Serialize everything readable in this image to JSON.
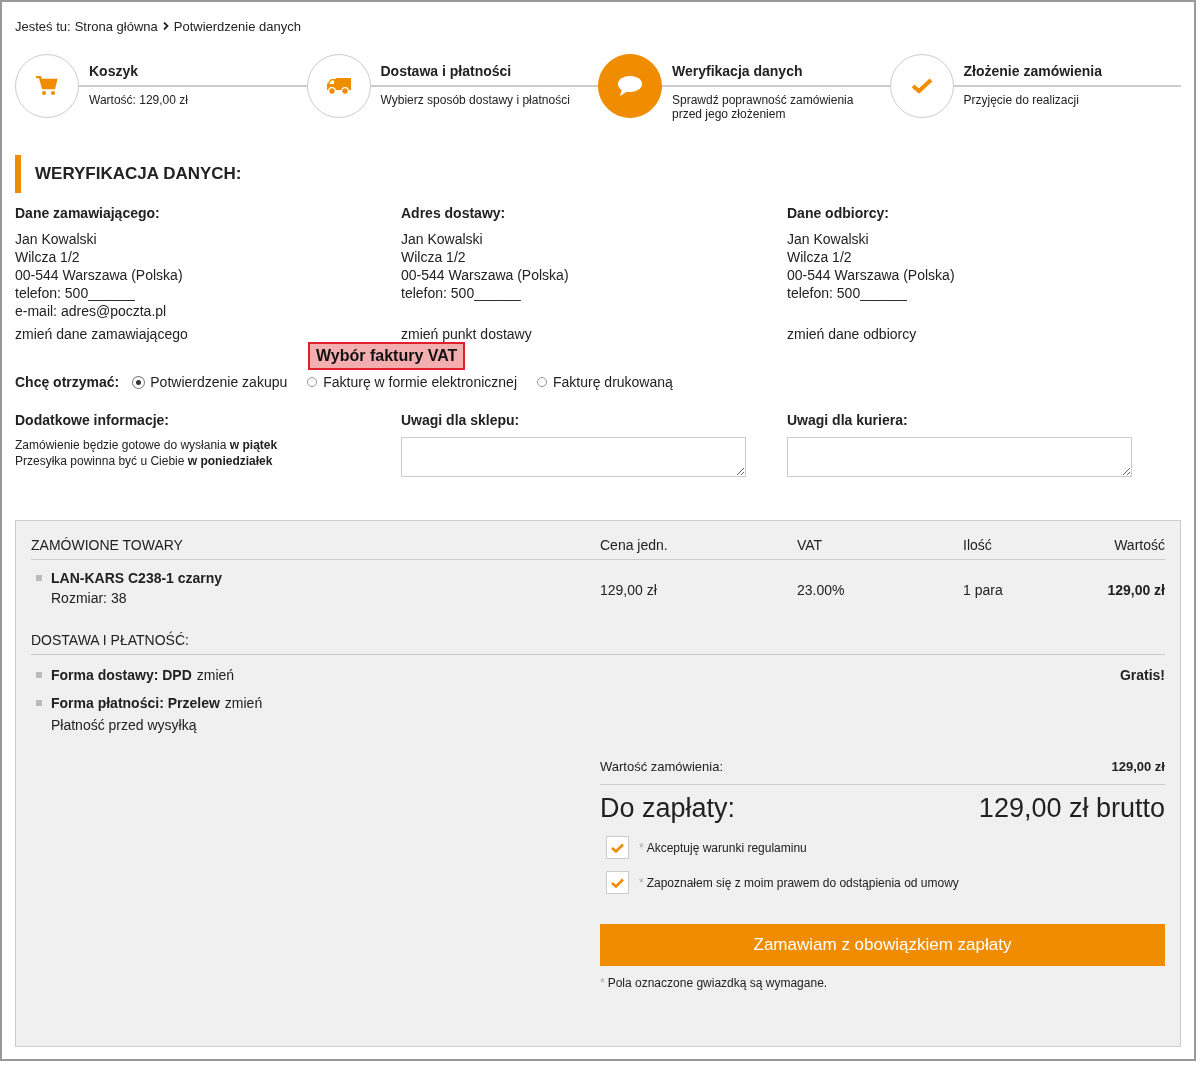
{
  "breadcrumb": {
    "label": "Jesteś tu:",
    "items": [
      "Strona główna",
      "Potwierdzenie danych"
    ]
  },
  "steps": [
    {
      "title": "Koszyk",
      "subtitle": "Wartość: 129,00 zł",
      "kind": "cart",
      "selected": false
    },
    {
      "title": "Dostawa i płatności",
      "subtitle": "Wybierz sposób dostawy i płatności",
      "kind": "truck",
      "selected": false
    },
    {
      "title": "Weryfikacja danych",
      "subtitle": "Sprawdź poprawność zamówienia przed jego złożeniem",
      "kind": "chat",
      "selected": true
    },
    {
      "title": "Złożenie zamówienia",
      "subtitle": "Przyjęcie do realizacji",
      "kind": "check",
      "selected": false
    }
  ],
  "section_title": "WERYFIKACJA DANYCH:",
  "addresses": [
    {
      "heading": "Dane zamawiającego:",
      "lines": [
        "Jan Kowalski",
        "Wilcza 1/2",
        "00-544 Warszawa (Polska)",
        "telefon: 500______",
        "e-mail: adres@poczta.pl"
      ],
      "link": "zmień dane zamawiającego"
    },
    {
      "heading": "Adres dostawy:",
      "lines": [
        "Jan Kowalski",
        "Wilcza 1/2",
        "00-544 Warszawa (Polska)",
        "telefon: 500______"
      ],
      "link": "zmień punkt dostawy"
    },
    {
      "heading": "Dane odbiorcy:",
      "lines": [
        "Jan Kowalski",
        "Wilcza 1/2",
        "00-544 Warszawa (Polska)",
        "telefon: 500______"
      ],
      "link": "zmień dane odbiorcy"
    }
  ],
  "callout": {
    "text": "Wybór faktury VAT"
  },
  "receive": {
    "label": "Chcę otrzymać:",
    "options": [
      {
        "label": "Potwierdzenie zakupu",
        "selected": true
      },
      {
        "label": "Fakturę w formie elektronicznej",
        "selected": false
      },
      {
        "label": "Fakturę drukowaną",
        "selected": false
      }
    ]
  },
  "additional": {
    "heading": "Dodatkowe informacje:",
    "lines": [
      "Zamówienie będzie gotowe do wysłania **w piątek**",
      "Przesyłka powinna być u Ciebie **w poniedziałek**"
    ]
  },
  "notes": [
    {
      "heading": "Uwagi dla sklepu:"
    },
    {
      "heading": "Uwagi dla kuriera:"
    }
  ],
  "order": {
    "columns": [
      "ZAMÓWIONE TOWARY",
      "Cena jedn.",
      "VAT",
      "Ilość",
      "Wartość"
    ],
    "rows": [
      {
        "name": "LAN-KARS C238-1 czarny",
        "size": "Rozmiar: 38",
        "price": "129,00 zł",
        "vat": "23.00%",
        "qty": "1 para",
        "value": "129,00 zł"
      }
    ]
  },
  "delivery": {
    "heading": "DOSTAWA I PŁATNOŚĆ:",
    "items": [
      {
        "label": "Forma dostawy: DPD",
        "link": "zmień",
        "value": "Gratis!"
      },
      {
        "label": "Forma płatności: Przelew",
        "link": "zmień",
        "detail": "Płatność przed wysyłką"
      }
    ]
  },
  "total": {
    "label": "Wartość zamówienia:",
    "value": "129,00 zł"
  },
  "due": {
    "label": "Do zapłaty:",
    "value": "129,00 zł brutto"
  },
  "consents": [
    {
      "mark": "*",
      "text": "Akceptuję warunki regulaminu",
      "checked": true
    },
    {
      "mark": "*",
      "text": "Zapoznałem się z moim prawem do odstąpienia od umowy",
      "checked": true
    }
  ],
  "submit": "Zamawiam z obowiązkiem zapłaty",
  "footnote": {
    "mark": "*",
    "text": "Pola oznaczone gwiazdką są wymagane."
  }
}
